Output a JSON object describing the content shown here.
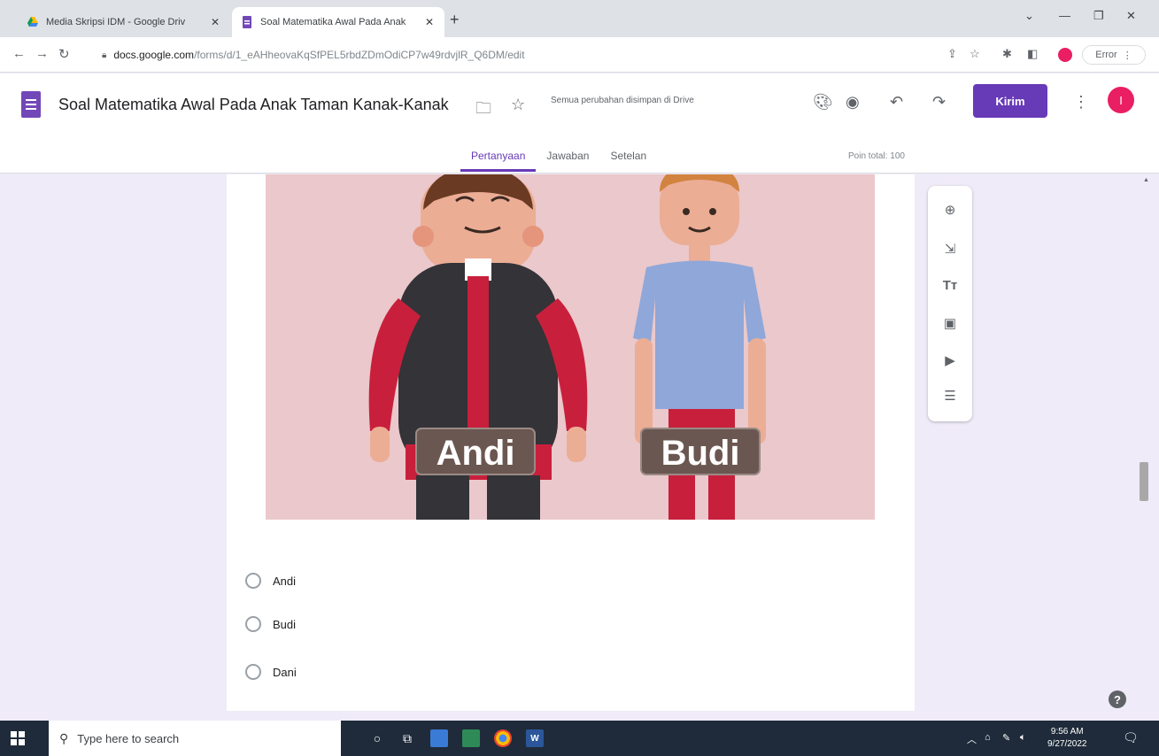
{
  "browser": {
    "tabs": [
      {
        "title": "Media Skripsi IDM - Google Driv",
        "active": false
      },
      {
        "title": "Soal Matematika Awal Pada Anak",
        "active": true
      }
    ],
    "new_tab": "+",
    "url_host": "docs.google.com",
    "url_path": "/forms/d/1_eAHheovaKqSfPEL5rbdZDmOdiCP7w49rdvjlR_Q6DM/edit",
    "error_label": "Error"
  },
  "forms": {
    "title": "Soal Matematika Awal Pada Anak Taman Kanak-Kanak",
    "saved_status": "Semua perubahan disimpan di Drive",
    "send_label": "Kirim",
    "avatar_initial": "I",
    "tabs": [
      {
        "label": "Pertanyaan",
        "active": true
      },
      {
        "label": "Jawaban",
        "active": false
      },
      {
        "label": "Setelan",
        "active": false
      }
    ],
    "total_points": "Poin total: 100"
  },
  "question": {
    "image_labels": [
      "Andi",
      "Budi"
    ],
    "options": [
      "Andi",
      "Budi",
      "Dani"
    ]
  },
  "toolbar": {
    "items": [
      "add-question",
      "import-questions",
      "add-title",
      "add-image",
      "add-video",
      "add-section"
    ]
  },
  "taskbar": {
    "search_placeholder": "Type here to search",
    "time": "9:56 AM",
    "date": "9/27/2022"
  },
  "colors": {
    "accent": "#673ab7",
    "avatar": "#e91e63",
    "background": "#f0ebf8",
    "illustration_bg": "#eac8cb"
  }
}
